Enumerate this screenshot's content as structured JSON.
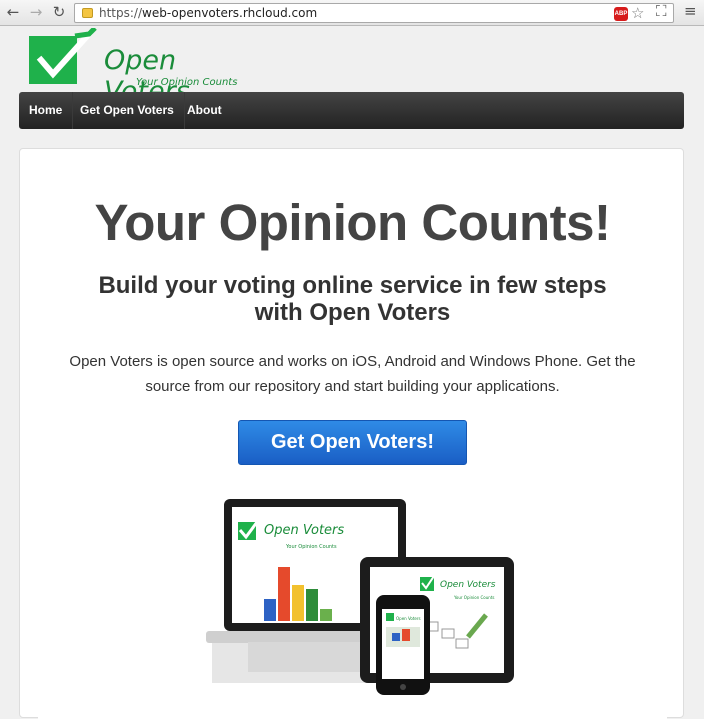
{
  "browser": {
    "url_protocol": "https://",
    "url_host": "web-openvoters.rhcloud.com",
    "adblock_label": "ABP"
  },
  "logo": {
    "title": "Open Voters",
    "subtitle": "Your Opinion Counts"
  },
  "nav": {
    "items": [
      "Home",
      "Get Open Voters",
      "About"
    ]
  },
  "hero": {
    "headline": "Your Opinion Counts!",
    "subheadline_line1": "Build your voting online service in few steps",
    "subheadline_line2": "with Open Voters",
    "lead": "Open Voters is open source and works on iOS, Android and Windows Phone. Get the source from our repository and start building your applications.",
    "cta_label": "Get Open Voters!"
  },
  "devices_image": {
    "laptop_title": "Open Voters",
    "laptop_subtitle": "Your Opinion Counts",
    "tablet_title": "Open Voters",
    "tablet_subtitle": "Your Opinion Counts",
    "phone_title": "Open Voters"
  },
  "colors": {
    "brand_green": "#1fb14b",
    "cta_blue": "#2a78dd",
    "nav_dark": "#333333"
  }
}
